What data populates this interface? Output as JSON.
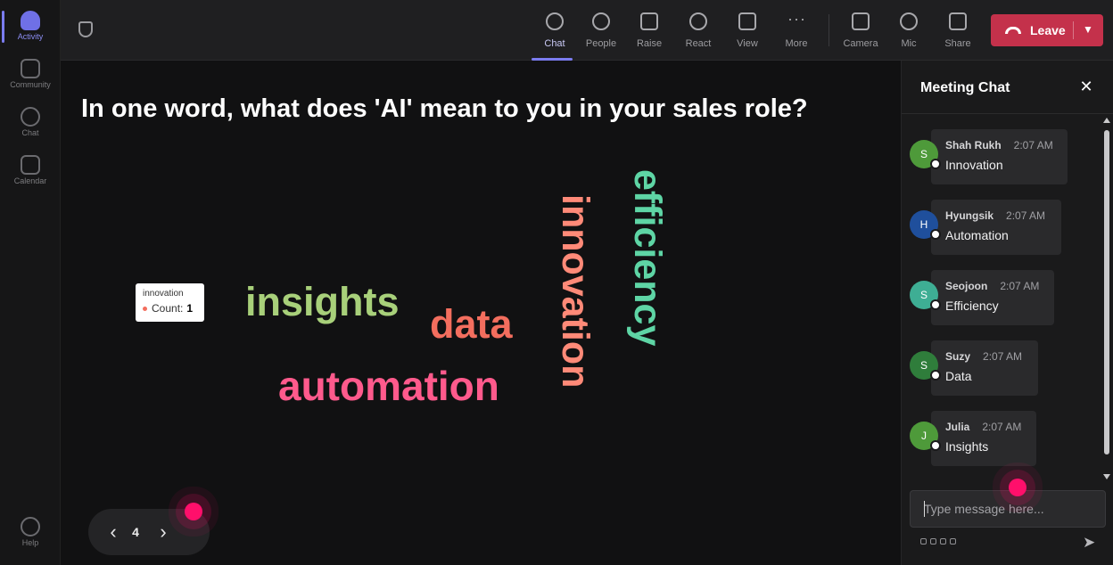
{
  "rail": {
    "items": [
      {
        "label": "Activity",
        "icon": "bell-icon"
      },
      {
        "label": "Community",
        "icon": "community-icon"
      },
      {
        "label": "Chat",
        "icon": "chat-icon"
      },
      {
        "label": "Calendar",
        "icon": "calendar-icon"
      },
      {
        "label": "Help",
        "icon": "help-icon"
      }
    ]
  },
  "toolbar": {
    "buttons": [
      {
        "label": "Chat",
        "icon": "chat-icon"
      },
      {
        "label": "People",
        "icon": "people-icon"
      },
      {
        "label": "Raise",
        "icon": "hand-icon"
      },
      {
        "label": "React",
        "icon": "smile-icon"
      },
      {
        "label": "View",
        "icon": "grid-icon"
      },
      {
        "label": "More",
        "icon": "more-icon"
      },
      {
        "label": "Camera",
        "icon": "camera-off-icon"
      },
      {
        "label": "Mic",
        "icon": "mic-icon"
      },
      {
        "label": "Share",
        "icon": "share-icon"
      }
    ],
    "leave_label": "Leave",
    "leave_color": "#c4314b",
    "accent": "#7b7cf0"
  },
  "stage": {
    "question": "In one word, what does 'AI' mean to you in your sales role?",
    "words": [
      {
        "text": "insights",
        "color": "#a8d07a"
      },
      {
        "text": "data",
        "color": "#f36e5e"
      },
      {
        "text": "automation",
        "color": "#ff5a8c"
      },
      {
        "text": "innovation",
        "color": "#ff8a78"
      },
      {
        "text": "efficiency",
        "color": "#5ed5a5"
      }
    ],
    "tooltip": {
      "word": "innovation",
      "count_label": "Count:",
      "count": "1"
    },
    "pager": {
      "page": "4",
      "prev": "‹",
      "next": "›"
    }
  },
  "chat": {
    "title": "Meeting Chat",
    "close": "✕",
    "messages": [
      {
        "initial": "S",
        "name": "Shah Rukh",
        "time": "2:07 AM",
        "text": "Innovation",
        "avatar_color": "#4e9a3a"
      },
      {
        "initial": "H",
        "name": "Hyungsik",
        "time": "2:07 AM",
        "text": "Automation",
        "avatar_color": "#1f4f9c"
      },
      {
        "initial": "S",
        "name": "Seojoon",
        "time": "2:07 AM",
        "text": "Efficiency",
        "avatar_color": "#3eae94"
      },
      {
        "initial": "S",
        "name": "Suzy",
        "time": "2:07 AM",
        "text": "Data",
        "avatar_color": "#2f7d3b"
      },
      {
        "initial": "J",
        "name": "Julia",
        "time": "2:07 AM",
        "text": "Insights",
        "avatar_color": "#4e9a3a"
      }
    ],
    "input_placeholder": "Type message here...",
    "send": "➤"
  }
}
